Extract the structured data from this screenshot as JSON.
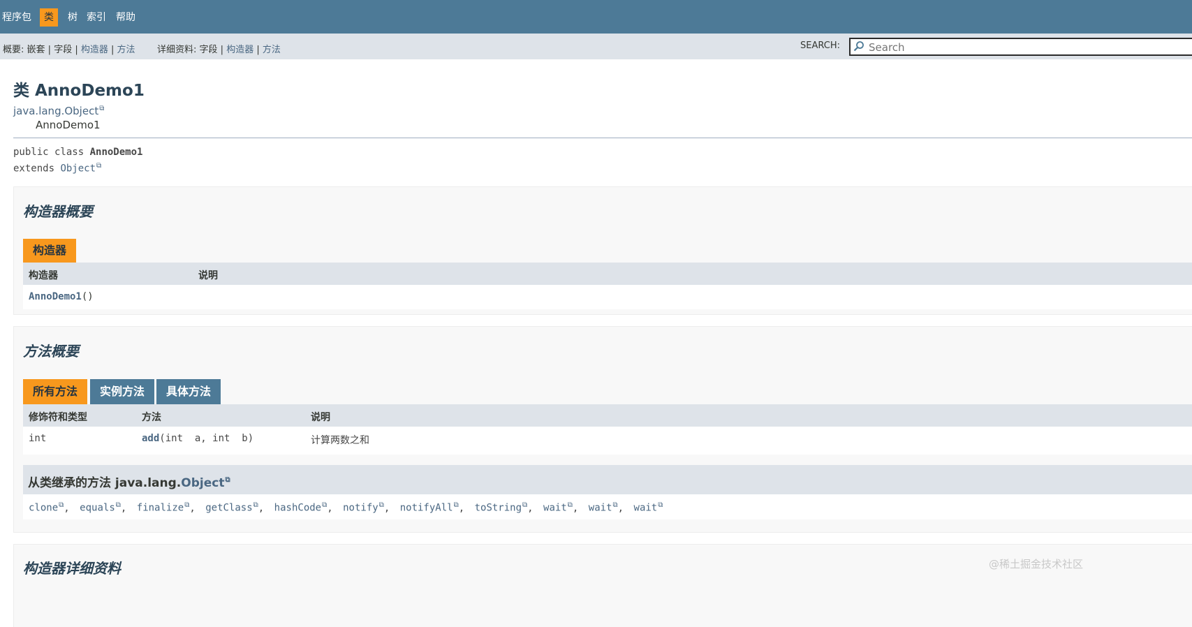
{
  "topnav": {
    "items": [
      {
        "label": "程序包",
        "active": false
      },
      {
        "label": "类",
        "active": true
      },
      {
        "label": "树",
        "active": false
      },
      {
        "label": "索引",
        "active": false
      },
      {
        "label": "帮助",
        "active": false
      }
    ]
  },
  "subnav": {
    "summary_label": "概要:",
    "summary_nested": "嵌套",
    "summary_field": "字段",
    "summary_constructor": "构造器",
    "summary_method": "方法",
    "detail_label": "详细资料:",
    "detail_field": "字段",
    "detail_constructor": "构造器",
    "detail_method": "方法",
    "search_label": "SEARCH:",
    "search_placeholder": "Search"
  },
  "header": {
    "title": "类 AnnoDemo1",
    "hierarchy_parent": "java.lang.Object",
    "hierarchy_child": "AnnoDemo1",
    "signature_prefix": "public class",
    "signature_name": "AnnoDemo1",
    "extends_keyword": "extends",
    "extends_type": "Object"
  },
  "constructor_summary": {
    "heading": "构造器概要",
    "tab": "构造器",
    "columns": [
      "构造器",
      "说明"
    ],
    "rows": [
      {
        "name": "AnnoDemo1",
        "params": "()",
        "description": ""
      }
    ]
  },
  "method_summary": {
    "heading": "方法概要",
    "tabs": [
      {
        "label": "所有方法",
        "active": true
      },
      {
        "label": "实例方法",
        "active": false
      },
      {
        "label": "具体方法",
        "active": false
      }
    ],
    "columns": [
      "修饰符和类型",
      "方法",
      "说明"
    ],
    "rows": [
      {
        "modifier": "int",
        "name": "add",
        "params": "(int  a, int  b)",
        "description": "计算两数之和"
      }
    ],
    "inherited_prefix": "从类继承的方法 java.lang.",
    "inherited_class": "Object",
    "inherited_methods": [
      "clone",
      "equals",
      "finalize",
      "getClass",
      "hashCode",
      "notify",
      "notifyAll",
      "toString",
      "wait",
      "wait",
      "wait"
    ]
  },
  "constructor_detail": {
    "heading": "构造器详细资料"
  },
  "watermark": "@稀土掘金技术社区",
  "colors": {
    "nav": "#4d7a97",
    "accent": "#f8981d",
    "subnav": "#dee3e9",
    "link": "#4a6782"
  }
}
